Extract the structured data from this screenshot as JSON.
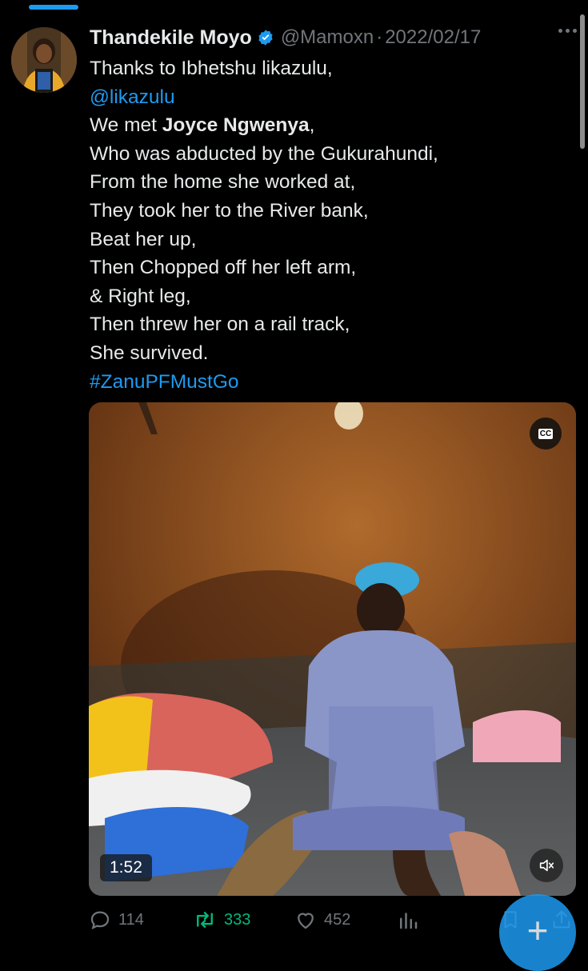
{
  "tweet": {
    "author_name": "Thandekile Moyo",
    "handle": "@Mamoxn",
    "separator": "·",
    "date": "2022/02/17",
    "lines": [
      [
        {
          "t": "Thanks to Ibhetshu likazulu,"
        }
      ],
      [
        {
          "t": "@likazulu",
          "link": true
        }
      ],
      [
        {
          "t": "We met "
        },
        {
          "t": "Joyce Ngwenya",
          "bold": true
        },
        {
          "t": ","
        }
      ],
      [
        {
          "t": "Who was abducted by the Gukurahundi,"
        }
      ],
      [
        {
          "t": "From the home she worked at,"
        }
      ],
      [
        {
          "t": "They took her to the River bank,"
        }
      ],
      [
        {
          "t": "Beat her up,"
        }
      ],
      [
        {
          "t": "Then Chopped off her left arm,"
        }
      ],
      [
        {
          "t": "& Right leg,"
        }
      ],
      [
        {
          "t": "Then threw her on a rail track,"
        }
      ],
      [
        {
          "t": "She survived."
        }
      ],
      [
        {
          "t": "#ZanuPFMustGo",
          "link": true
        }
      ]
    ]
  },
  "video": {
    "cc_label": "CC",
    "duration": "1:52"
  },
  "actions": {
    "replies": "114",
    "retweets": "333",
    "likes": "452"
  },
  "colors": {
    "accent": "#1d9bf0",
    "retweet": "#00ba7c",
    "muted": "#71767b",
    "background": "#000000"
  }
}
